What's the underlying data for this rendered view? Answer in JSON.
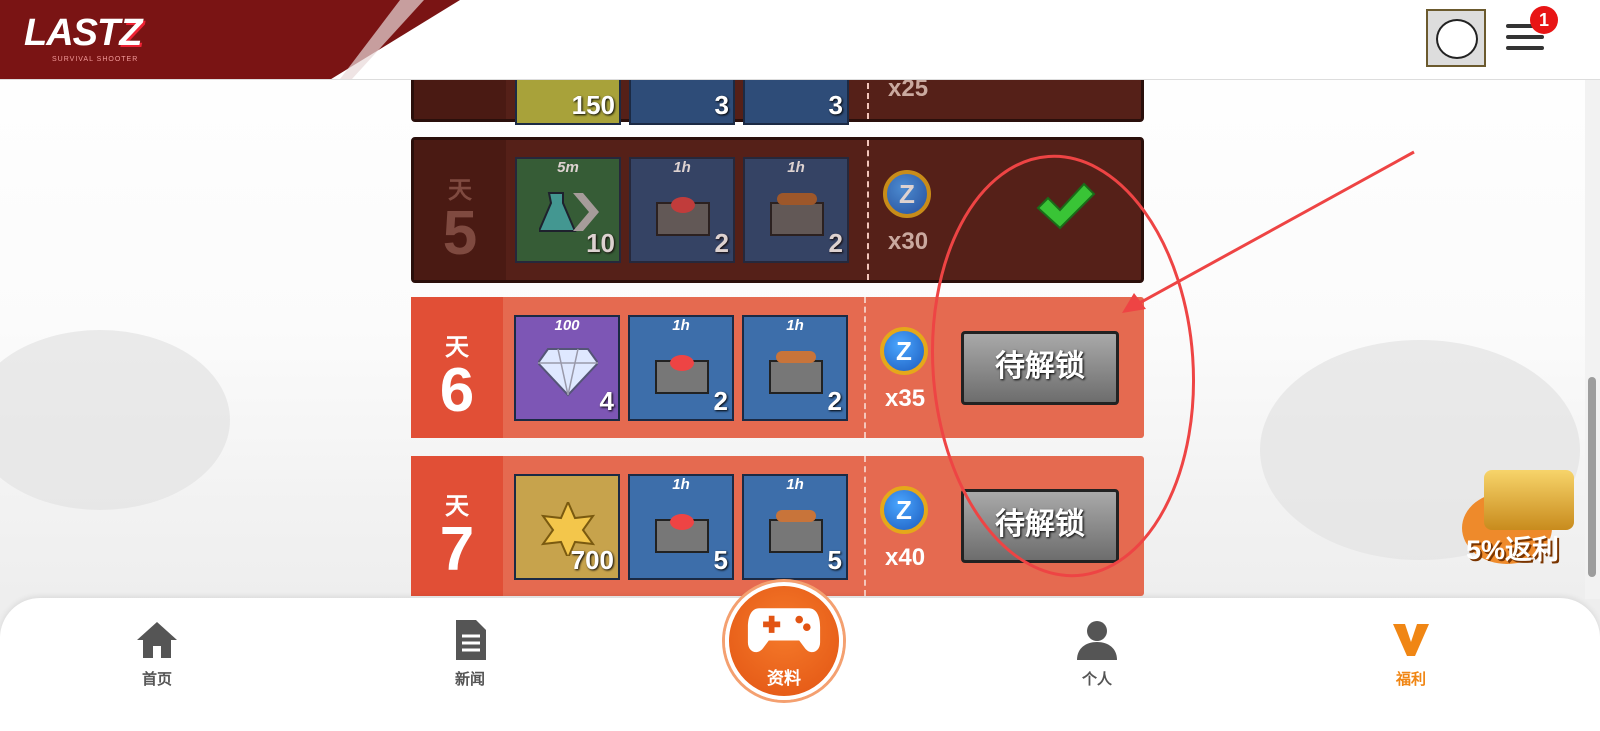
{
  "header": {
    "logo_text": "LAST",
    "logo_z": "Z",
    "logo_subtitle": "SURVIVAL SHOOTER",
    "notification_count": "1"
  },
  "rewards": {
    "day_label": "天",
    "partial_row": {
      "qty1": "150",
      "qty2": "3",
      "qty3": "3",
      "coin_qty": "x25"
    },
    "rows": [
      {
        "day": "5",
        "status": "claimed",
        "items": [
          {
            "icon": "speedup-potion-icon",
            "time": "5m",
            "qty": "10"
          },
          {
            "icon": "food-crate-icon",
            "time": "1h",
            "qty": "2"
          },
          {
            "icon": "wood-crate-icon",
            "time": "1h",
            "qty": "2"
          }
        ],
        "coin_qty": "x30"
      },
      {
        "day": "6",
        "status": "locked",
        "button_label": "待解锁",
        "items": [
          {
            "icon": "diamond-icon",
            "time": "100",
            "qty": "4"
          },
          {
            "icon": "food-crate-icon",
            "time": "1h",
            "qty": "2"
          },
          {
            "icon": "wood-crate-icon",
            "time": "1h",
            "qty": "2"
          }
        ],
        "coin_qty": "x35"
      },
      {
        "day": "7",
        "status": "locked",
        "button_label": "待解锁",
        "items": [
          {
            "icon": "sheriff-badge-icon",
            "time": "",
            "qty": "700"
          },
          {
            "icon": "food-crate-icon",
            "time": "1h",
            "qty": "5"
          },
          {
            "icon": "wood-crate-icon",
            "time": "1h",
            "qty": "5"
          }
        ],
        "coin_qty": "x40"
      }
    ]
  },
  "promo": {
    "label": "5%返利"
  },
  "nav": {
    "home": "首页",
    "news": "新闻",
    "center": "资料",
    "profile": "个人",
    "welfare": "福利"
  },
  "colors": {
    "accent": "#f08614",
    "row_light": "#e56a50",
    "row_dark": "#552018",
    "annotation": "#ee4444"
  }
}
